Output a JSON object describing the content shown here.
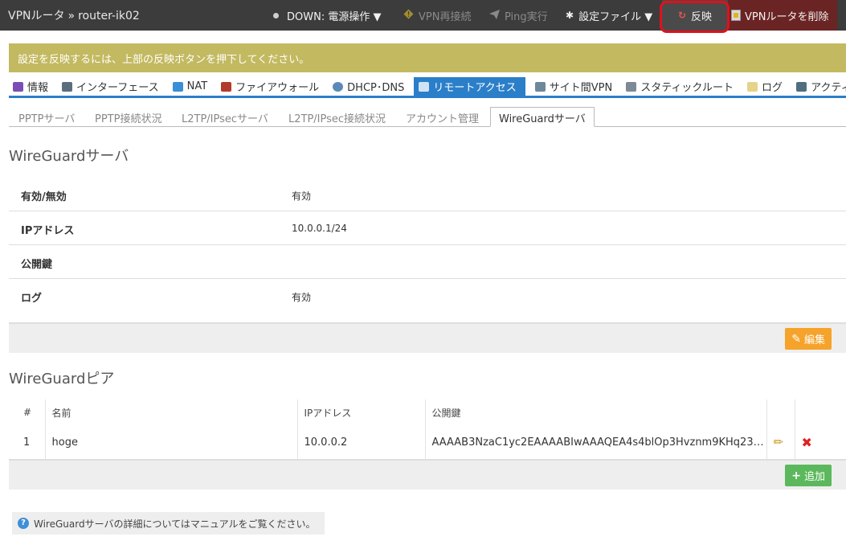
{
  "header": {
    "app": "VPNルータ",
    "separator": "»",
    "router": "router-ik02",
    "status": "DOWN: 電源操作 ▼",
    "reconnect": "VPN再接続",
    "ping": "Ping実行",
    "config": "設定ファイル ▼",
    "apply": "反映",
    "delete": "VPNルータを削除"
  },
  "notice": "設定を反映するには、上部の反映ボタンを押下してください。",
  "main_tabs": [
    "情報",
    "インターフェース",
    "NAT",
    "ファイアウォール",
    "DHCP･DNS",
    "リモートアクセス",
    "サイト間VPN",
    "スタティックルート",
    "ログ",
    "アクティビティ"
  ],
  "sub_tabs": [
    "PPTPサーバ",
    "PPTP接続状況",
    "L2TP/IPsecサーバ",
    "L2TP/IPsec接続状況",
    "アカウント管理",
    "WireGuardサーバ"
  ],
  "server": {
    "title": "WireGuardサーバ",
    "rows": [
      {
        "label": "有効/無効",
        "value": "有効"
      },
      {
        "label": "IPアドレス",
        "value": "10.0.0.1/24"
      },
      {
        "label": "公開鍵",
        "value": ""
      },
      {
        "label": "ログ",
        "value": "有効"
      }
    ],
    "edit_button": "編集"
  },
  "peers": {
    "title": "WireGuardピア",
    "columns": [
      "#",
      "名前",
      "IPアドレス",
      "公開鍵"
    ],
    "rows": [
      {
        "num": "1",
        "name": "hoge",
        "ip": "10.0.0.2",
        "key": "AAAAB3NzaC1yc2EAAAABIwAAAQEA4s4blOp3Hvznm9KHq23…"
      }
    ],
    "add_button": "追加"
  },
  "help": "WireGuardサーバの詳細についてはマニュアルをご覧ください。",
  "colors": {
    "topbar": "#3c3c3c",
    "notice": "#c3b960",
    "accent": "#2b7fc9",
    "edit": "#f5a32a",
    "add": "#5cb85c",
    "highlight": "#e0111b"
  }
}
